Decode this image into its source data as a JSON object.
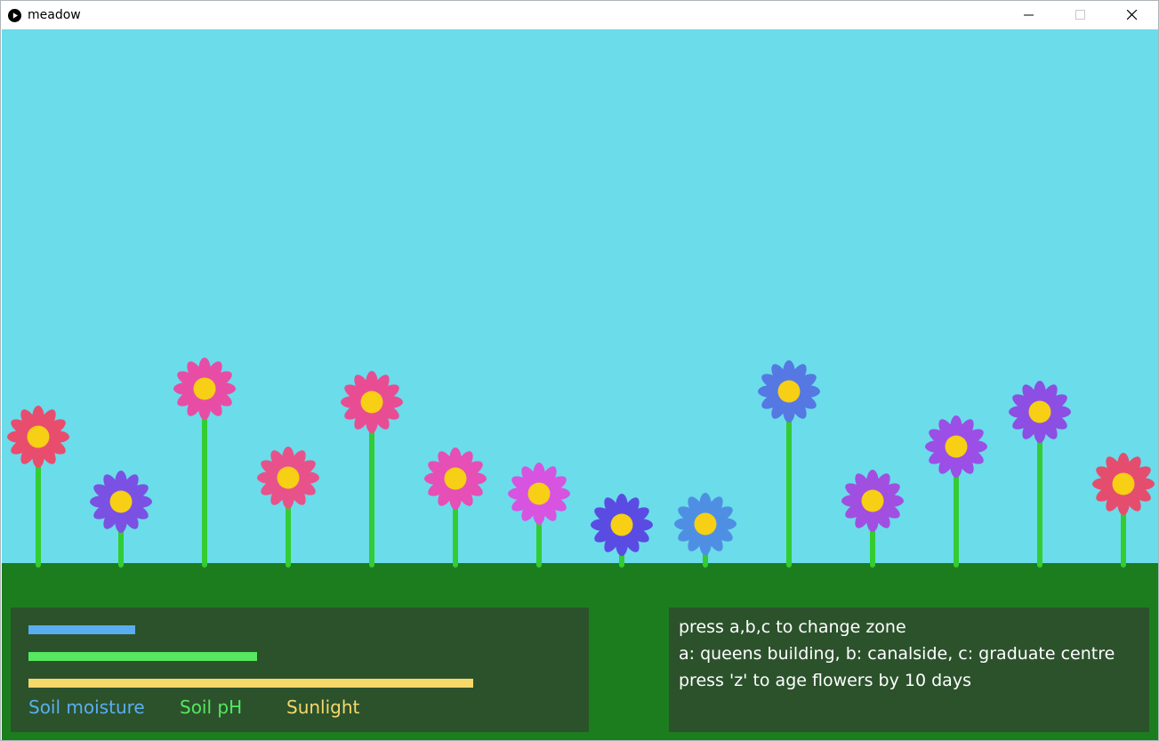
{
  "window": {
    "title": "meadow",
    "icon": "play-circle-icon",
    "controls": [
      "minimize-icon",
      "maximize-icon",
      "close-icon"
    ]
  },
  "colors": {
    "sky": "#6bdcea",
    "ground": "#1c7d1e",
    "panel": "#2c522c",
    "stem": "#33cc33",
    "flower_center": "#f7cf14",
    "moisture": "#5aaef0",
    "ph": "#55e860",
    "sunlight": "#f5d86a"
  },
  "meters": [
    {
      "label": "Soil moisture",
      "fraction": 0.24,
      "color": "#5aaef0"
    },
    {
      "label": "Soil pH",
      "fraction": 0.514,
      "color": "#55e860"
    },
    {
      "label": "Sunlight",
      "fraction": 1.0,
      "color": "#f5d86a"
    }
  ],
  "instructions": [
    "press a,b,c to change zone",
    "a: queens building, b: canalside, c: graduate centre",
    "press 'z' to age flowers by 10 days"
  ],
  "flowers": [
    {
      "color": "#e84d6e"
    },
    {
      "color": "#7a51e3"
    },
    {
      "color": "#e84da6"
    },
    {
      "color": "#e8528a"
    },
    {
      "color": "#e84d93"
    },
    {
      "color": "#e64fb5"
    },
    {
      "color": "#d754e0"
    },
    {
      "color": "#5a4ce3"
    },
    {
      "color": "#4f8fe3"
    },
    {
      "color": "#5578e3"
    },
    {
      "color": "#a14fe0"
    },
    {
      "color": "#9b4fe6"
    },
    {
      "color": "#8c4ee3"
    },
    {
      "color": "#e44d6e"
    }
  ]
}
